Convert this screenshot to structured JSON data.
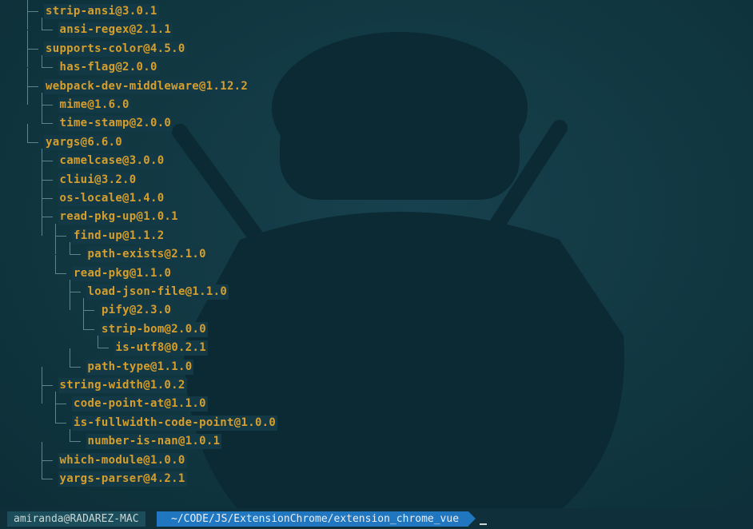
{
  "tree": {
    "entries": [
      {
        "label": "strip-ansi@3.0.1"
      },
      {
        "label": "ansi-regex@2.1.1"
      },
      {
        "label": "supports-color@4.5.0"
      },
      {
        "label": "has-flag@2.0.0"
      },
      {
        "label": "webpack-dev-middleware@1.12.2"
      },
      {
        "label": "mime@1.6.0"
      },
      {
        "label": "time-stamp@2.0.0"
      },
      {
        "label": "yargs@6.6.0"
      },
      {
        "label": "camelcase@3.0.0"
      },
      {
        "label": "cliui@3.2.0"
      },
      {
        "label": "os-locale@1.4.0"
      },
      {
        "label": "read-pkg-up@1.0.1"
      },
      {
        "label": "find-up@1.1.2"
      },
      {
        "label": "path-exists@2.1.0"
      },
      {
        "label": "read-pkg@1.1.0"
      },
      {
        "label": "load-json-file@1.1.0"
      },
      {
        "label": "pify@2.3.0"
      },
      {
        "label": "strip-bom@2.0.0"
      },
      {
        "label": "is-utf8@0.2.1"
      },
      {
        "label": "path-type@1.1.0"
      },
      {
        "label": "string-width@1.0.2"
      },
      {
        "label": "code-point-at@1.1.0"
      },
      {
        "label": "is-fullwidth-code-point@1.0.0"
      },
      {
        "label": "number-is-nan@1.0.1"
      },
      {
        "label": "which-module@1.0.0"
      },
      {
        "label": "yargs-parser@4.2.1"
      }
    ]
  },
  "prompt": {
    "user": "amiranda@RADAREZ-MAC",
    "path": "~/CODE/JS/ExtensionChrome/extension_chrome_vue"
  },
  "colors": {
    "background": "#10363f",
    "package_text": "#d69f2d",
    "tree_lines": "#5c8590",
    "path_segment": "#2077bf",
    "user_segment": "#1b4d5a"
  }
}
